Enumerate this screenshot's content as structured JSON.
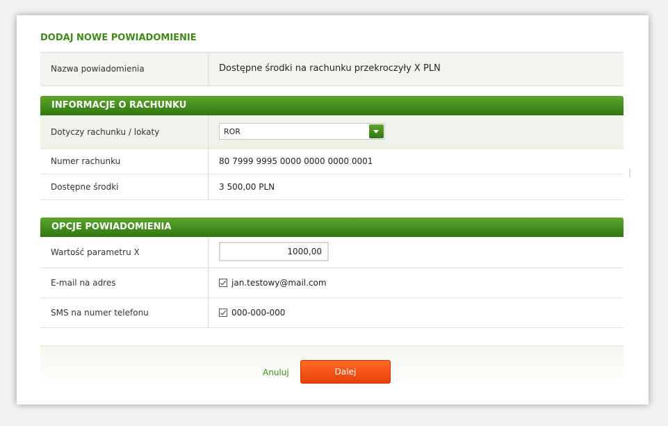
{
  "title": "DODAJ NOWE POWIADOMIENIE",
  "notification_name": {
    "label": "Nazwa powiadomienia",
    "value": "Dostępne środki na rachunku przekroczyły X PLN"
  },
  "account_section": {
    "header": "INFORMACJE O RACHUNKU",
    "account_select": {
      "label": "Dotyczy rachunku / lokaty",
      "value": "ROR"
    },
    "account_number": {
      "label": "Numer rachunku",
      "value": "80 7999 9995 0000 0000 0000 0001"
    },
    "available_funds": {
      "label": "Dostępne środki",
      "value": "3 500,00 PLN"
    }
  },
  "options_section": {
    "header": "OPCJE POWIADOMIENIA",
    "param_x": {
      "label": "Wartość parametru X",
      "value": "1000,00"
    },
    "email": {
      "label": "E-mail na adres",
      "value": "jan.testowy@mail.com",
      "checked": true
    },
    "sms": {
      "label": "SMS na numer telefonu",
      "value": "000-000-000",
      "checked": true
    }
  },
  "buttons": {
    "cancel": "Anuluj",
    "next": "Dalej"
  },
  "colors": {
    "accent_green": "#3f8a18",
    "header_green": "#2f7610",
    "next_orange": "#f04e10"
  }
}
